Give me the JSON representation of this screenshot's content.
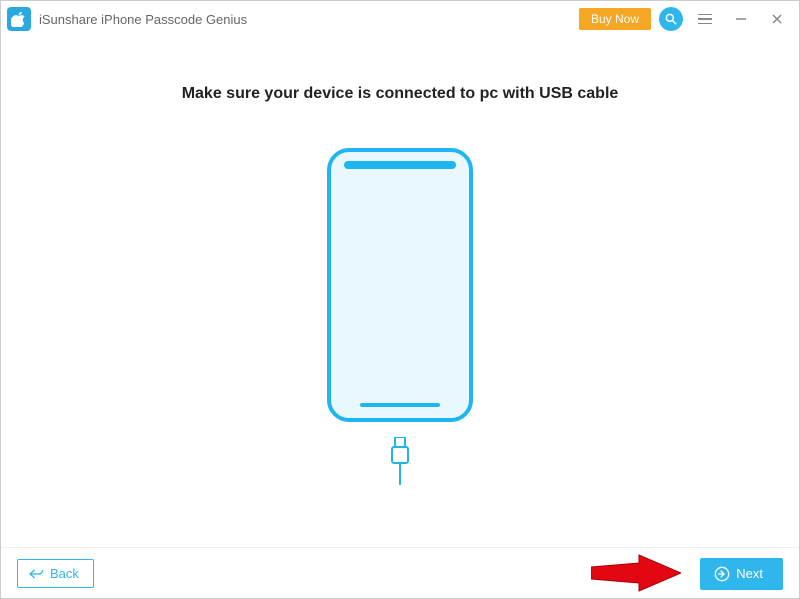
{
  "app": {
    "title": "iSunshare iPhone Passcode Genius"
  },
  "titlebar": {
    "buy_now_label": "Buy Now"
  },
  "main": {
    "instruction": "Make sure your device is connected to pc with USB cable"
  },
  "footer": {
    "back_label": "Back",
    "next_label": "Next"
  },
  "colors": {
    "accent": "#2fb7ed",
    "orange": "#f5a623",
    "arrow": "#e30613"
  }
}
